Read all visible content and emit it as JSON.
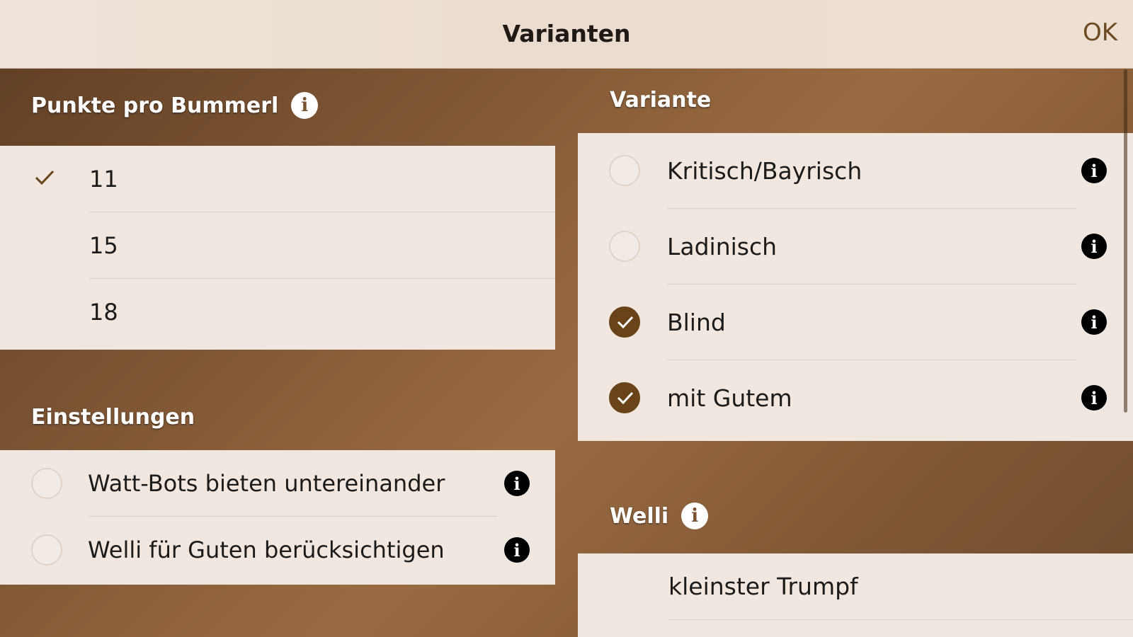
{
  "header": {
    "title": "Varianten",
    "ok_label": "OK"
  },
  "points": {
    "title": "Punkte pro Bummerl",
    "options": [
      {
        "label": "11",
        "selected": true
      },
      {
        "label": "15",
        "selected": false
      },
      {
        "label": "18",
        "selected": false
      }
    ]
  },
  "settings": {
    "title": "Einstellungen",
    "items": [
      {
        "label": "Watt-Bots bieten untereinander",
        "checked": false
      },
      {
        "label": "Welli für Guten berücksichtigen",
        "checked": false
      }
    ]
  },
  "variant": {
    "title": "Variante",
    "items": [
      {
        "label": "Kritisch/Bayrisch",
        "checked": false
      },
      {
        "label": "Ladinisch",
        "checked": false
      },
      {
        "label": "Blind",
        "checked": true
      },
      {
        "label": "mit Gutem",
        "checked": true
      }
    ]
  },
  "welli": {
    "title": "Welli",
    "items": [
      {
        "label": "kleinster Trumpf"
      }
    ]
  },
  "icons": {
    "info": "info-icon",
    "check": "checkmark-icon"
  },
  "colors": {
    "accent": "#6a4418",
    "panel": "#efe7e0",
    "background": "#85593a"
  }
}
